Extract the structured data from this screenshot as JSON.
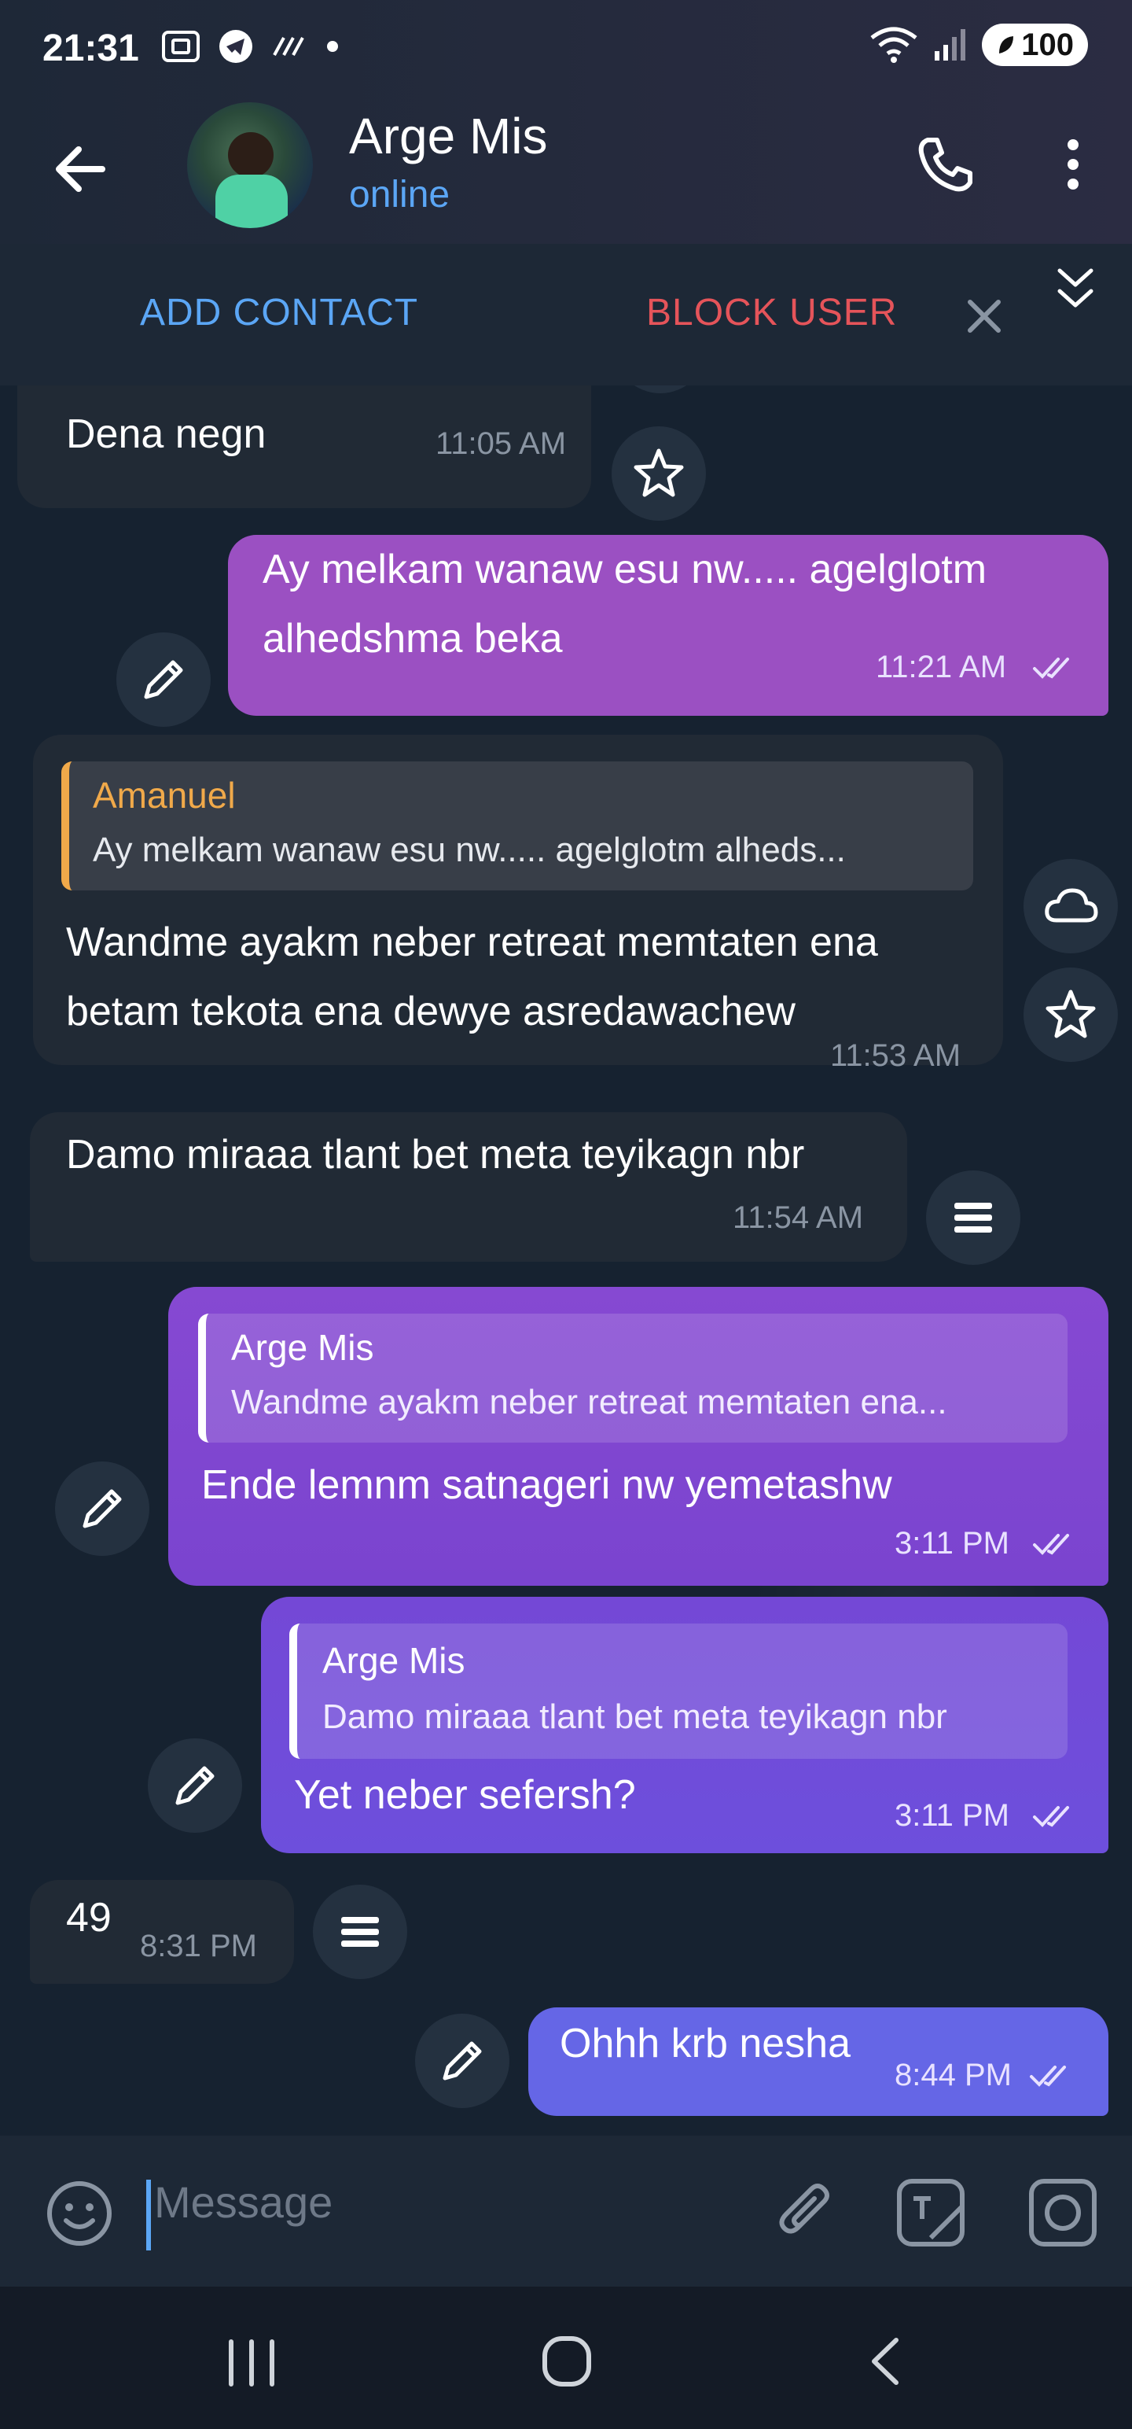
{
  "status_bar": {
    "time": "21:31",
    "battery": "100"
  },
  "header": {
    "contact_name": "Arge Mis",
    "contact_status": "online"
  },
  "actions": {
    "add_contact": "ADD CONTACT",
    "block_user": "BLOCK USER"
  },
  "messages": [
    {
      "text": "Dena negn",
      "time": "11:05 AM",
      "direction": "in"
    },
    {
      "text_line1": "Ay melkam wanaw esu nw..... agelglotm",
      "text_line2": "alhedshma beka",
      "time": "11:21 AM",
      "direction": "out"
    },
    {
      "reply_name": "Amanuel",
      "reply_text": "Ay melkam wanaw esu nw..... agelglotm alheds...",
      "text_line1": "Wandme ayakm neber retreat memtaten ena",
      "text_line2": "betam tekota ena dewye asredawachew",
      "time": "11:53 AM",
      "direction": "in"
    },
    {
      "text": "Damo miraaa tlant bet meta teyikagn nbr",
      "time": "11:54 AM",
      "direction": "in"
    },
    {
      "reply_name": "Arge Mis",
      "reply_text": "Wandme ayakm neber retreat memtaten ena...",
      "text": "Ende lemnm satnageri nw yemetashw",
      "time": "3:11 PM",
      "direction": "out"
    },
    {
      "reply_name": "Arge Mis",
      "reply_text": "Damo miraaa tlant bet meta teyikagn nbr",
      "text": "Yet neber sefersh?",
      "time": "3:11 PM",
      "direction": "out"
    },
    {
      "text": "49",
      "time": "8:31 PM",
      "direction": "in"
    },
    {
      "text": "Ohhh krb nesha",
      "time": "8:44 PM",
      "direction": "out"
    }
  ],
  "input": {
    "placeholder": "Message"
  },
  "colors": {
    "accent": "#5ba6f5",
    "danger": "#e5545a",
    "reply_orange": "#f0a94a",
    "incoming_bubble": "#212a35"
  }
}
